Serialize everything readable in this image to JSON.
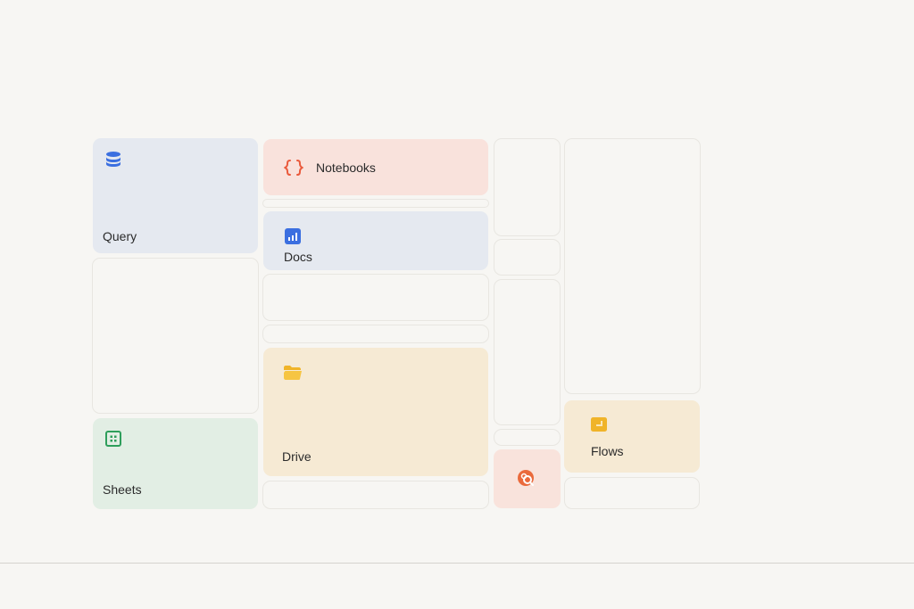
{
  "tiles": {
    "query": {
      "label": "Query"
    },
    "notebooks": {
      "label": "Notebooks"
    },
    "docs": {
      "label": "Docs"
    },
    "drive": {
      "label": "Drive"
    },
    "sheets": {
      "label": "Sheets"
    },
    "flows": {
      "label": "Flows"
    }
  },
  "colors": {
    "background": "#f7f6f3",
    "query_tile": "#e5e9f0",
    "notebooks_tile": "#f9e2dc",
    "docs_tile": "#e5e9f0",
    "drive_tile": "#f6ead4",
    "sheets_tile": "#e2eee4",
    "flows_tile": "#f6ead4",
    "search_tile": "#f9e3dc",
    "query_icon": "#3b6fe0",
    "notebooks_icon": "#ea5a3c",
    "docs_icon": "#3b6fe0",
    "drive_icon": "#f0b429",
    "sheets_icon": "#2e9e5b",
    "flows_icon": "#f0b429",
    "search_icon": "#ea6a3c"
  },
  "icons": {
    "query": "database-icon",
    "notebooks": "braces-icon",
    "docs": "bar-chart-icon",
    "drive": "folder-icon",
    "sheets": "grid-icon",
    "flows": "image-icon",
    "search": "search-icon"
  }
}
